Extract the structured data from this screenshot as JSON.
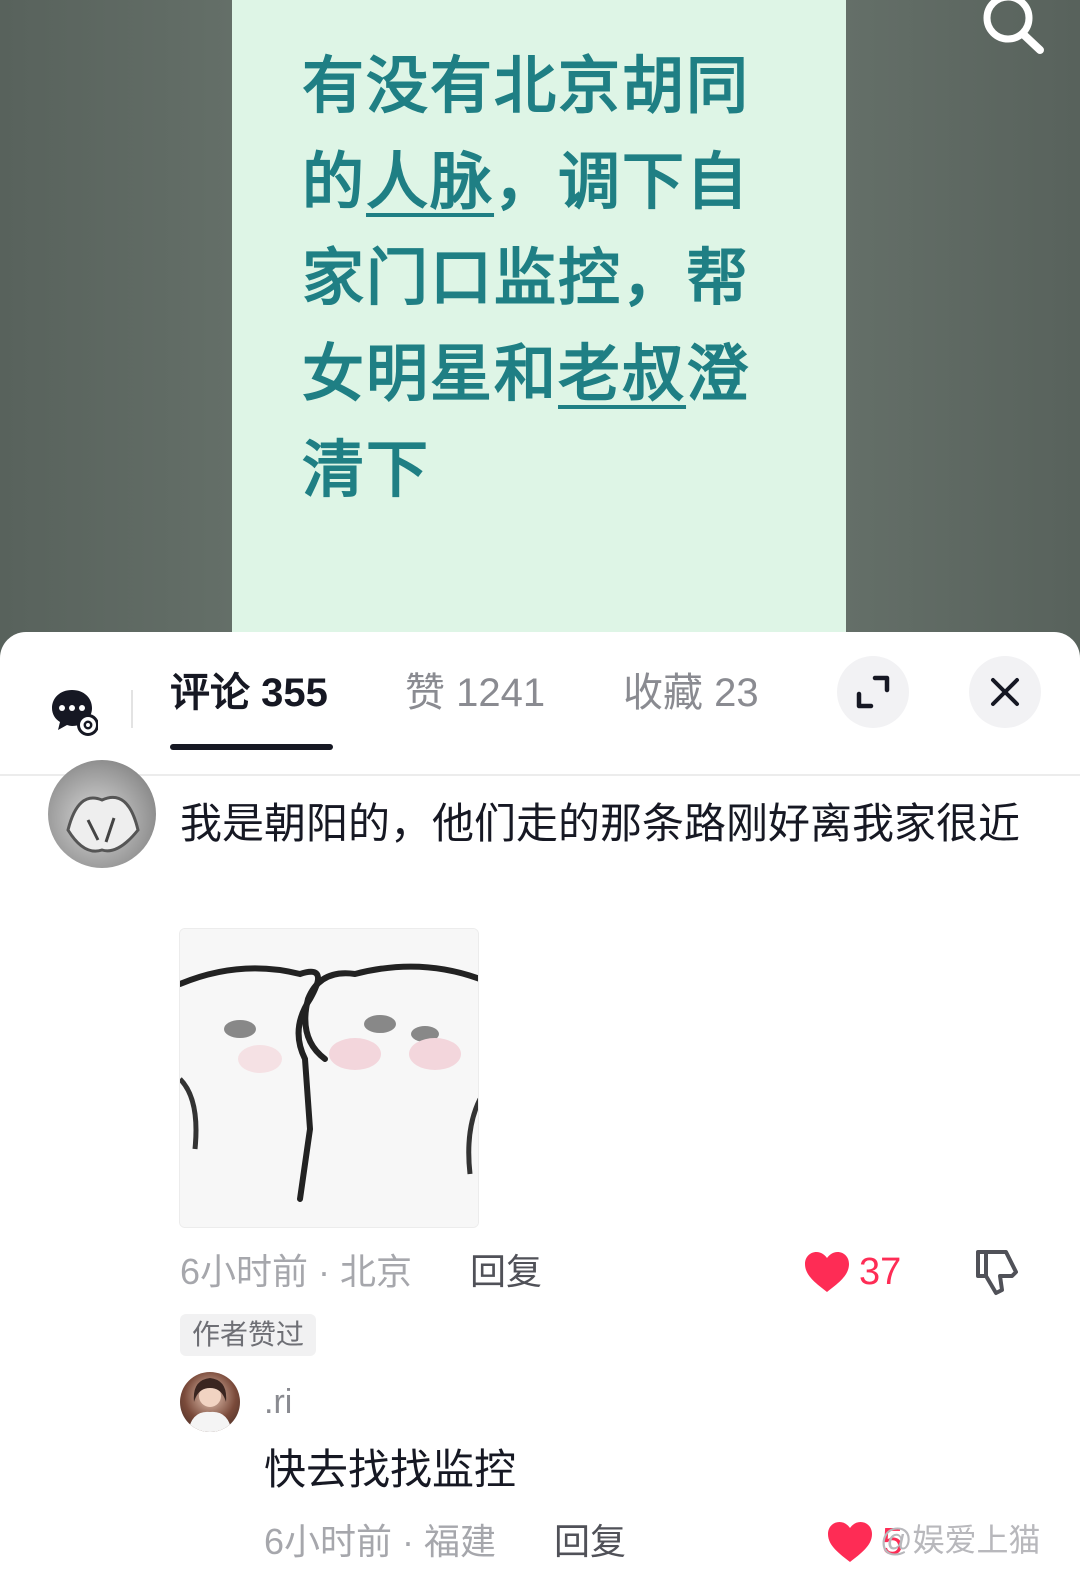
{
  "video": {
    "poster_lines": [
      "有没有北京胡同",
      "的",
      "人脉",
      "，调下自",
      "家门口监控，帮",
      "女明星和",
      "老叔",
      "澄",
      "清下"
    ],
    "search_icon": "search-icon",
    "poster_bg": "#def5e6",
    "poster_text_color": "#1f7f84"
  },
  "tabs": {
    "comments_label": "评论 355",
    "likes_label": "赞 1241",
    "favorites_label": "收藏 23"
  },
  "comment": {
    "text": "我是朝阳的，他们走的那条路刚好离我家很近",
    "time_location": "6小时前 · 北京",
    "reply_label": "回复",
    "like_count": "37",
    "author_badge": "作者赞过"
  },
  "sub_reply": {
    "username": ".ri",
    "text": "快去找找监控",
    "time_location": "6小时前 · 福建",
    "reply_label": "回复",
    "like_count": "5"
  },
  "watermark": "@娱爱上猫",
  "colors": {
    "accent": "#fe2c55",
    "primary_text": "#161823",
    "muted_text": "#a6a7ac"
  }
}
